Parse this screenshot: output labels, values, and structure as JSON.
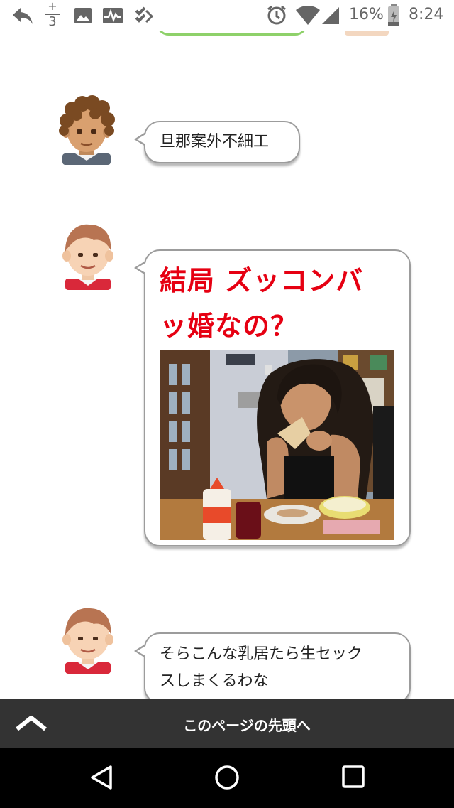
{
  "status_bar": {
    "battery_percent": "16%",
    "time": "8:24",
    "fraction_top": "+",
    "fraction_bottom": "3"
  },
  "messages": [
    {
      "text": "旦那案外不細工"
    },
    {
      "headline_line1": "結局 ズッコンバ",
      "headline_line2": "ッ婚なの？"
    },
    {
      "text_line1": "そらこんな乳居たら生セック",
      "text_line2": "スしまくるわな"
    }
  ],
  "footer": {
    "back_to_top_label": "このページの先頭へ"
  },
  "colors": {
    "headline_red": "#e60012",
    "footer_bar": "#333333",
    "partial_bubble_border": "#8ed16a"
  },
  "icons": {
    "status_left": [
      "reply-icon",
      "fraction-icon",
      "image-icon",
      "activity-icon",
      "checklist-icon"
    ],
    "status_right": [
      "alarm-icon",
      "wifi-icon",
      "signal-icon",
      "battery-icon"
    ],
    "nav": [
      "back-triangle-icon",
      "home-circle-icon",
      "recents-square-icon"
    ]
  }
}
